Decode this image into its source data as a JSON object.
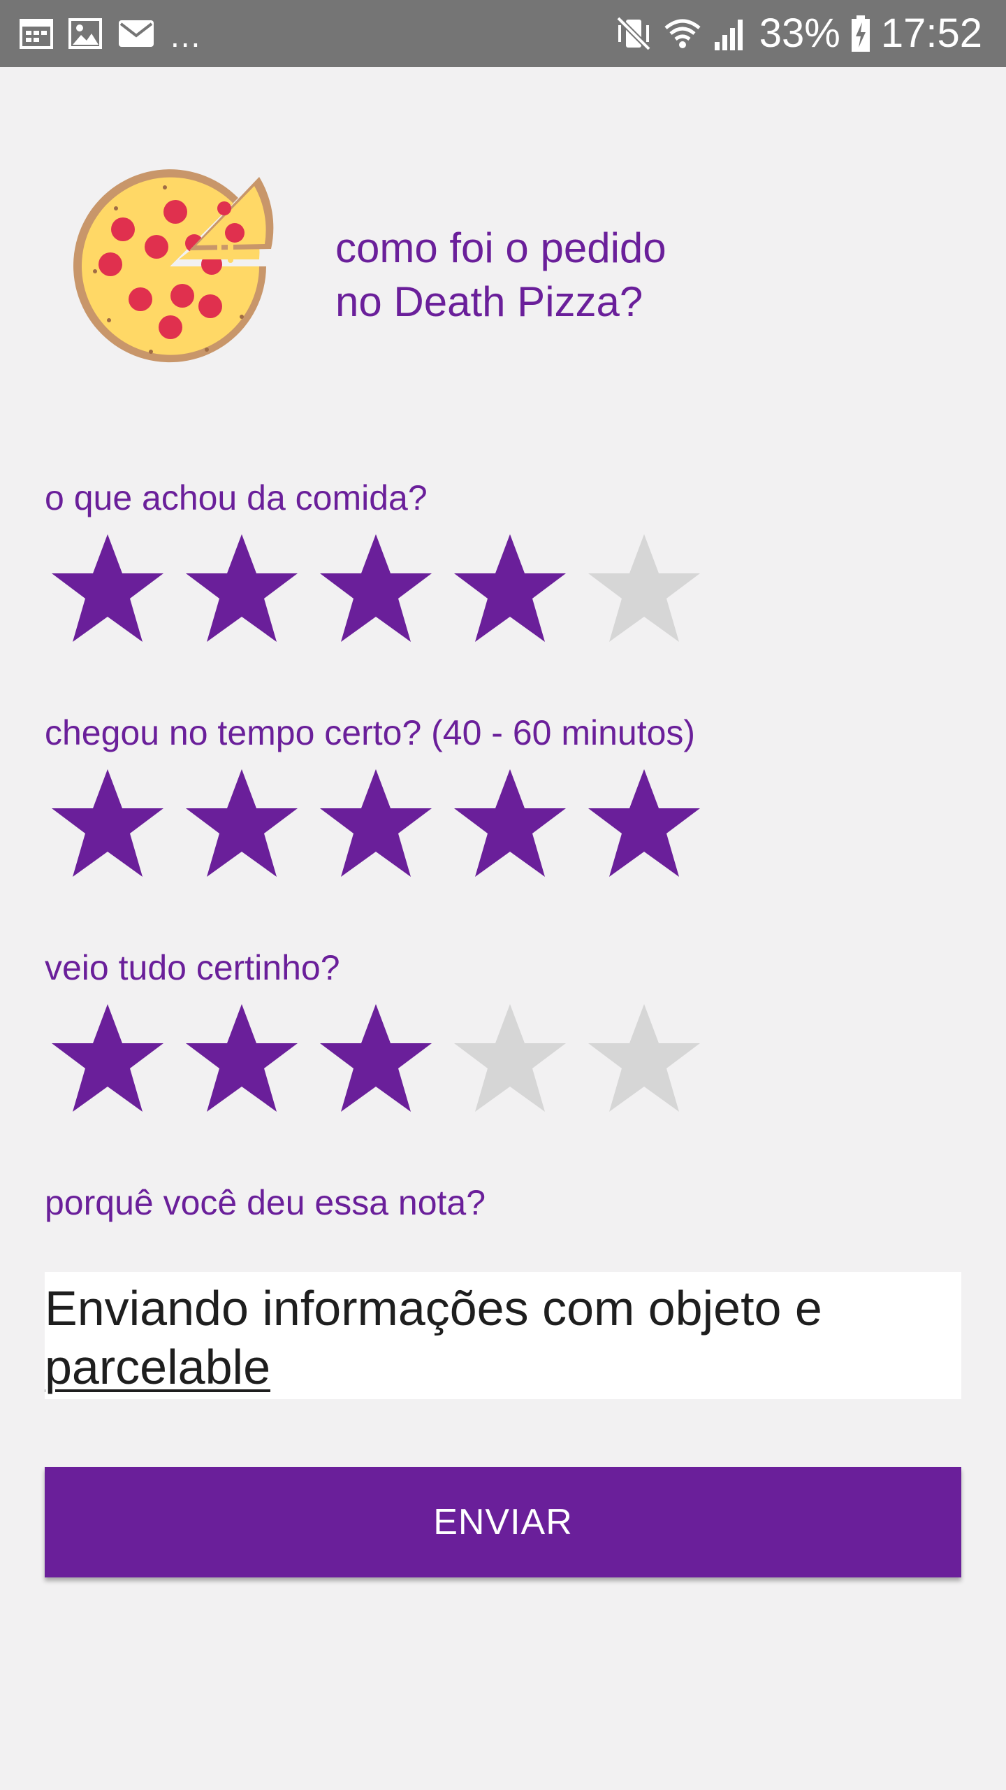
{
  "status_bar": {
    "icons_left": [
      "calendar-icon",
      "image-icon",
      "mail-icon"
    ],
    "overflow": "...",
    "icons_right": [
      "vibrate-mute-icon",
      "wifi-icon",
      "signal-icon",
      "battery-charging-icon"
    ],
    "battery": "33%",
    "time": "17:52"
  },
  "header": {
    "logo_icon": "pizza-icon",
    "title_line1": "como foi o pedido",
    "title_line2": "no Death Pizza?"
  },
  "colors": {
    "accent": "#6a1f9a",
    "star_empty": "#d6d6d6",
    "background": "#f2f1f2",
    "status_bar": "#757575"
  },
  "questions": [
    {
      "label": "o que achou da comida?",
      "rating": 4,
      "max": 5
    },
    {
      "label": "chegou no tempo certo? (40 - 60 minutos)",
      "rating": 5,
      "max": 5
    },
    {
      "label": "veio tudo certinho?",
      "rating": 3,
      "max": 5
    }
  ],
  "comment": {
    "label": "porquê você deu essa nota?",
    "value_part1": "Enviando informações com objeto e",
    "value_part2": "parcelable"
  },
  "submit": {
    "label": "ENVIAR"
  }
}
